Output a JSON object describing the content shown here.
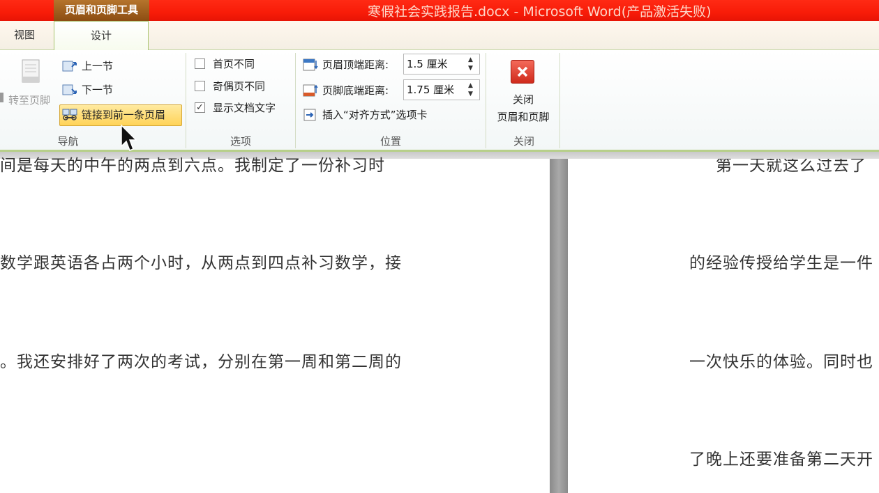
{
  "window": {
    "context_tool": "页眉和页脚工具",
    "title": "寒假社会实践报告.docx - Microsoft Word(产品激活失败)"
  },
  "tabs": {
    "view": "视图",
    "design": "设计"
  },
  "nav_group": {
    "goto_footer": "转至页脚",
    "prev_section": "上一节",
    "next_section": "下一节",
    "link_to_previous": "链接到前一条页眉",
    "label": "导航"
  },
  "options_group": {
    "diff_first": "首页不同",
    "diff_odd_even": "奇偶页不同",
    "show_doc_text": "显示文档文字",
    "show_doc_text_checkmark": "✓",
    "label": "选项"
  },
  "position_group": {
    "header_dist_label": "页眉顶端距离:",
    "header_dist_value": "1.5 厘米",
    "footer_dist_label": "页脚底端距离:",
    "footer_dist_value": "1.75 厘米",
    "insert_align_tab": "插入“对齐方式”选项卡",
    "label": "位置"
  },
  "close_group": {
    "close_line1": "关闭",
    "close_line2": "页眉和页脚",
    "label": "关闭"
  },
  "document": {
    "left_lines": [
      "间是每天的中午的两点到六点。我制定了一份补习时",
      "数学跟英语各占两个小时，从两点到四点补习数学，接",
      "。我还安排好了两次的考试，分别在第一周和第二周的"
    ],
    "right_lines": [
      "第一天就这么过去了",
      "的经验传授给学生是一件",
      "一次快乐的体验。同时也",
      "了晚上还要准备第二天开"
    ]
  }
}
